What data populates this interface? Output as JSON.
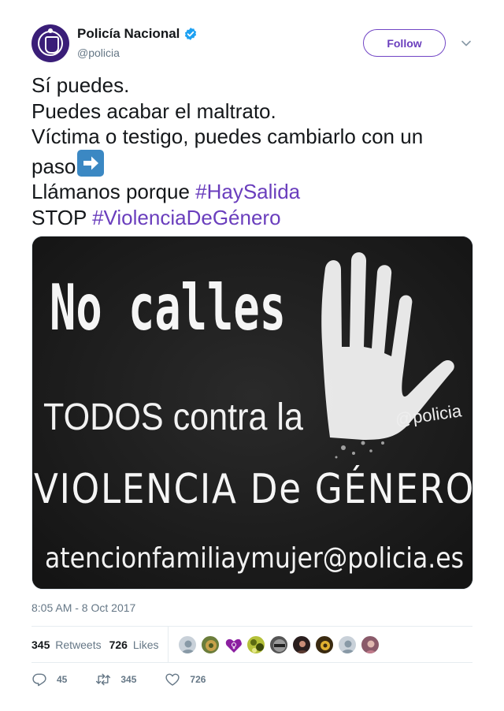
{
  "user": {
    "name": "Policía Nacional",
    "handle": "@policia",
    "verified_icon": "verified-badge-icon",
    "avatar_icon": "police-crest-icon",
    "follow_label": "Follow"
  },
  "tweet": {
    "lines": {
      "l1": "Sí puedes.",
      "l2": "Puedes acabar el maltrato.",
      "l3": "Víctima o testigo, puedes cambiarlo con un",
      "l4": "paso",
      "l5_prefix": "Llámanos porque ",
      "l5_hashtag": "#HaySalida",
      "l6_prefix": "STOP ",
      "l6_hashtag": "#ViolenciaDeGénero"
    },
    "emoji": "right-arrow-emoji",
    "timestamp": "8:05 AM - 8 Oct 2017"
  },
  "media": {
    "line1": "No calles",
    "line2": "TODOS contra la",
    "line3": "VIOLENCIA De GÉNERO",
    "line4": "atencionfamiliaymujer@policia.es",
    "watermark": "@policia",
    "hand_icon": "open-hand-icon"
  },
  "stats": {
    "retweets_count": "345",
    "retweets_label": "Retweets",
    "likes_count": "726",
    "likes_label": "Likes"
  },
  "actions": {
    "reply_count": "45",
    "retweet_count": "345",
    "like_count": "726"
  },
  "colors": {
    "accent": "#6a3ebd",
    "verified": "#1da1f2",
    "muted": "#657786"
  }
}
